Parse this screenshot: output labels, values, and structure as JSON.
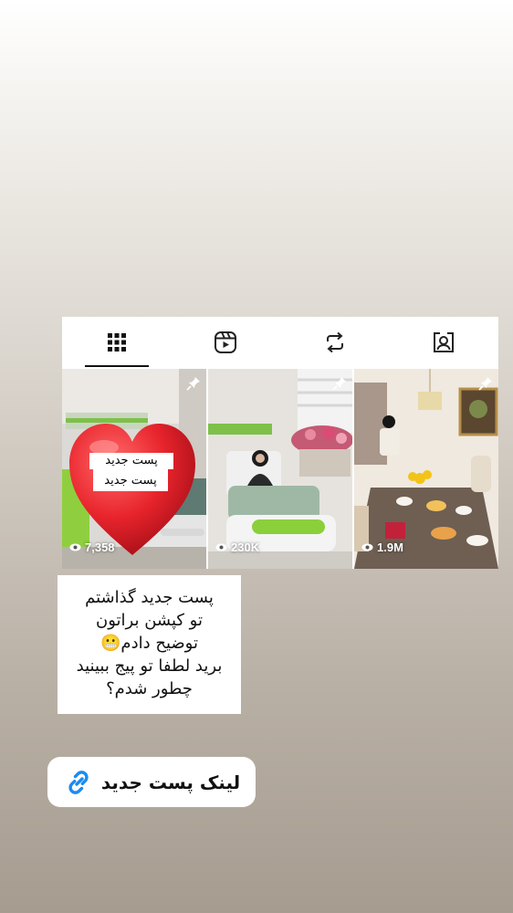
{
  "profile_grid": {
    "tabs": [
      {
        "name": "posts",
        "icon": "grid-icon",
        "active": true
      },
      {
        "name": "reels",
        "icon": "reels-icon",
        "active": false
      },
      {
        "name": "reposts",
        "icon": "repost-icon",
        "active": false
      },
      {
        "name": "tagged",
        "icon": "tagged-icon",
        "active": false
      }
    ],
    "posts": [
      {
        "views": "7,358",
        "pinned": true,
        "scene": "hospital-room"
      },
      {
        "views": "230K",
        "pinned": true,
        "scene": "woman-in-hospital-bed"
      },
      {
        "views": "1.9M",
        "pinned": true,
        "scene": "dining-table"
      }
    ]
  },
  "heart_sticker": {
    "label": "پست جدید",
    "label_ghost": "پست جدید",
    "color": "#e8242c"
  },
  "caption": {
    "lines": [
      "پست جدید گذاشتم",
      "تو کپشن براتون",
      "توضیح دادم😬",
      "برید لطفا تو پیج ببینید",
      "چطور شدم؟"
    ]
  },
  "link_sticker": {
    "text": "لینک پست جدید",
    "icon": "link-icon",
    "icon_color": "#1a8cf0"
  }
}
